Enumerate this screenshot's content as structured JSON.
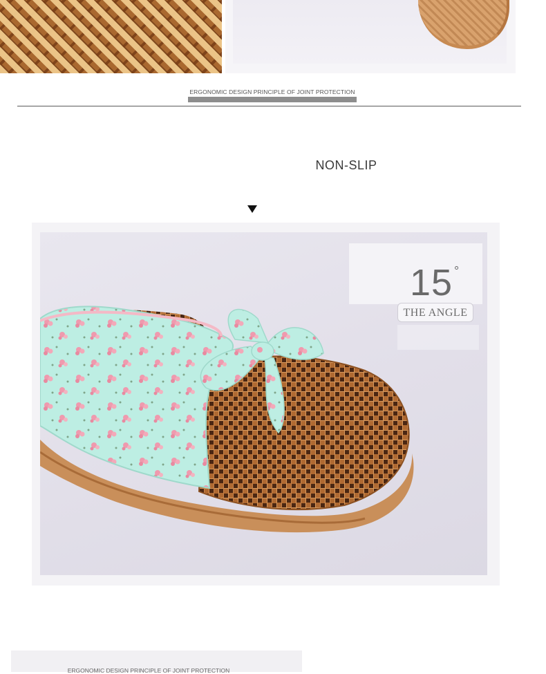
{
  "top_section": {
    "caption": "ERGONOMIC DESIGN PRINCIPLE OF JOINT PROTECTION"
  },
  "feature": {
    "title": "NON-SLIP",
    "arrow": "down-arrow-icon"
  },
  "angle_badge": {
    "number": "15",
    "degree": "°",
    "label": "THE ANGLE"
  },
  "bottom_section": {
    "caption": "ERGONOMIC DESIGN PRINCIPLE OF JOINT PROTECTION"
  },
  "colors": {
    "rattan": "#a9682f",
    "fabric": "#b8ece0",
    "flower": "#ef9aae",
    "background": "#e6e3ec"
  }
}
